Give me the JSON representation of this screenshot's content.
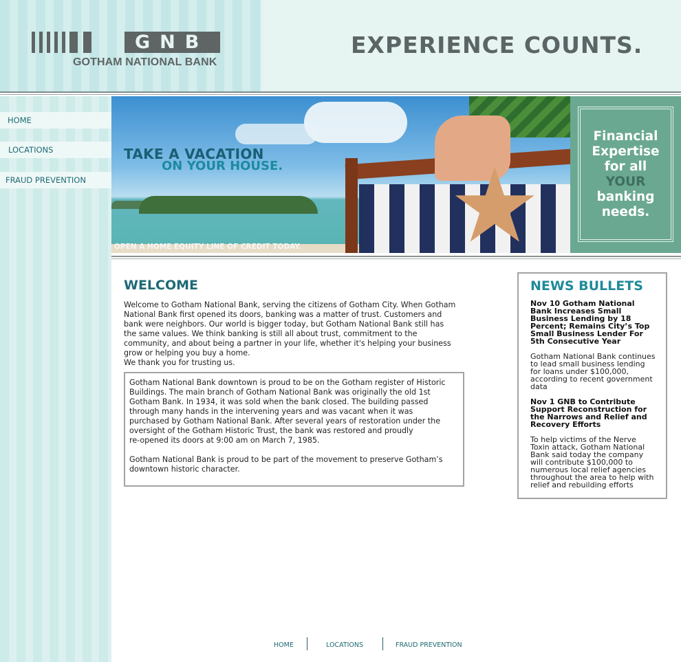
{
  "header": {
    "logo_letters": "GNB",
    "bank_name": "GOTHAM NATIONAL BANK",
    "tagline": "EXPERIENCE COUNTS."
  },
  "sidebar": {
    "items": [
      {
        "label": "HOME"
      },
      {
        "label": "LOCATIONS"
      },
      {
        "label": "FRAUD PREVENTION"
      }
    ]
  },
  "banner": {
    "headline_1": "TAKE A VACATION",
    "headline_2": "ON YOUR HOUSE.",
    "cta": "OPEN A HOME EQUITY LINE OF CREDIT TODAY."
  },
  "promo": {
    "line_1": "Financial",
    "line_2": "Expertise",
    "line_3": "for all",
    "line_4": "YOUR",
    "line_5": "banking",
    "line_6": "needs."
  },
  "welcome": {
    "title": "WELCOME",
    "body": "Welcome to Gotham National Bank, serving the citizens of Gotham City. When Gotham\nNational Bank first opened its doors, banking was a matter of trust. Customers and\nbank were neighbors. Our world is bigger today, but Gotham National Bank still has\nthe same values. We think banking is still all about trust, commitment to the\ncommunity, and about being a partner in your life, whether it's helping your business\ngrow or helping you buy a home.\nWe thank you for trusting us.",
    "history": "Gotham National Bank downtown is proud to be on the Gotham register of Historic\nBuildings. The main branch of Gotham National Bank was originally the old 1st\nGotham Bank. In 1934, it was sold when the bank closed. The building passed\nthrough many hands in the intervening years and was vacant when it was\npurchased by Gotham National Bank. After several years of restoration under the\noversight of the Gotham Historic Trust, the bank was restored and proudly\nre-opened its doors at 9:00 am on March 7, 1985.\n\nGotham National Bank is proud to be part of the movement to preserve Gotham’s\ndowntown historic character."
  },
  "news": {
    "title": "NEWS BULLETS",
    "items": [
      {
        "headline": "Nov 10 Gotham National\nBank Increases Small\nBusiness Lending by 18\nPercent; Remains City’s Top\nSmall Business Lender For\n5th Consecutive Year",
        "body": "Gotham National Bank continues\nto lead small business lending\nfor loans under $100,000,\naccording to recent government\ndata"
      },
      {
        "headline": "Nov 1 GNB to Contribute\nSupport Reconstruction for\nthe Narrows and Relief and\nRecovery Efforts",
        "body": "To help victims of the Nerve\nToxin attack, Gotham National\nBank said today the company\nwill contribute $100,000 to\nnumerous local relief agencies\nthroughout the area to help with\nrelief and rebuilding efforts"
      }
    ]
  },
  "footer": {
    "links": [
      {
        "label": "HOME"
      },
      {
        "label": "LOCATIONS"
      },
      {
        "label": "FRAUD PREVENTION"
      }
    ]
  },
  "colors": {
    "brand_teal": "#1d6a76",
    "logo_gray": "#5e6564",
    "promo_green": "#6aa891"
  }
}
